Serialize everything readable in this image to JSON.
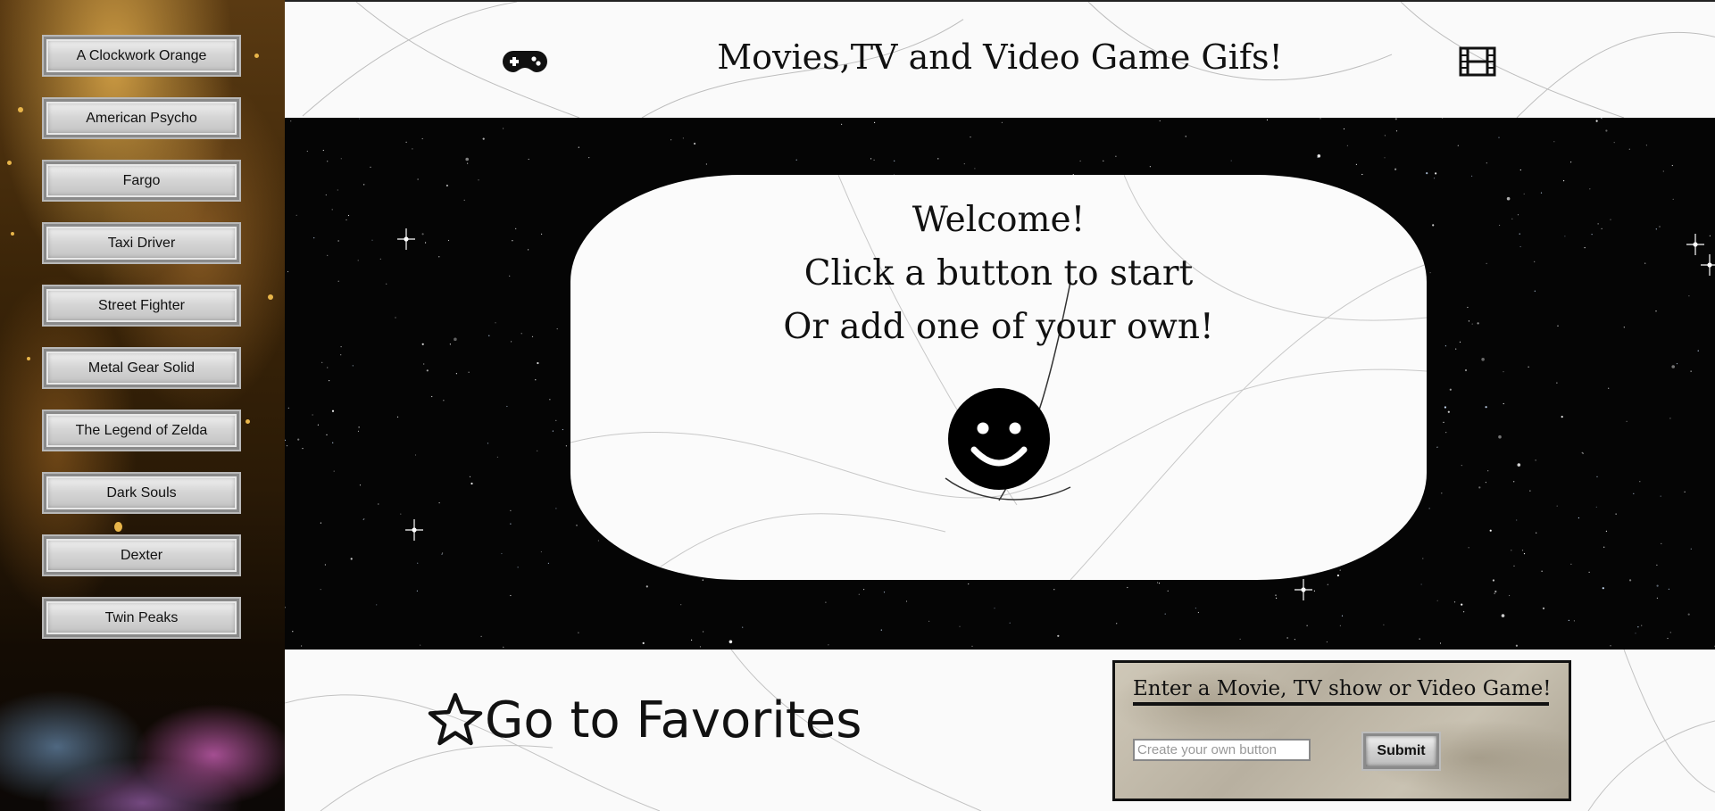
{
  "sidebar": {
    "buttons": [
      "A Clockwork Orange",
      "American Psycho",
      "Fargo",
      "Taxi Driver",
      "Street Fighter",
      "Metal Gear Solid",
      "The Legend of Zelda",
      "Dark Souls",
      "Dexter",
      "Twin Peaks"
    ]
  },
  "header": {
    "title": "Movies,TV and Video Game Gifs!",
    "left_icon": "gamepad-icon",
    "right_icon": "film-icon"
  },
  "welcome": {
    "line1": "Welcome!",
    "line2": "Click a button to start",
    "line3": "Or add one of your own!",
    "icon": "smiley-icon"
  },
  "favorites": {
    "label": "Go to Favorites",
    "icon": "star-icon"
  },
  "add_form": {
    "heading": "Enter a Movie, TV show or Video Game!",
    "input_placeholder": "Create your own button",
    "input_value": "",
    "submit_label": "Submit"
  },
  "colors": {
    "stars_background": "#050505",
    "panel_background": "#fafafa",
    "text": "#111111"
  }
}
